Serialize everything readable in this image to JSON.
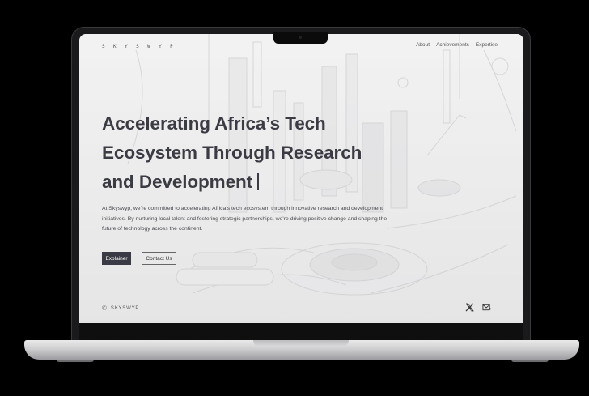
{
  "site": {
    "logo": "S K Y S W Y P",
    "nav": [
      "About",
      "Achievements",
      "Expertise"
    ]
  },
  "hero": {
    "headline_lines": [
      "Accelerating Africa’s Tech",
      "Ecosystem Through Research",
      "and Development"
    ],
    "description": "At Skyswyp, we’re committed to accelerating Africa’s tech ecosystem through innovative research and development initiatives. By nurturing local talent and fostering strategic partnerships, we’re driving positive change and shaping the future of technology across the continent.",
    "primary_button": "Explainer",
    "secondary_button": "Contact Us"
  },
  "footer": {
    "copyright_symbol": "©",
    "brand": "SKYSWYP",
    "social_icons": [
      "x-icon",
      "mail-icon"
    ]
  },
  "colors": {
    "headline": "#3b3b43",
    "primary_button": "#3a3a44",
    "background": "#000000"
  }
}
